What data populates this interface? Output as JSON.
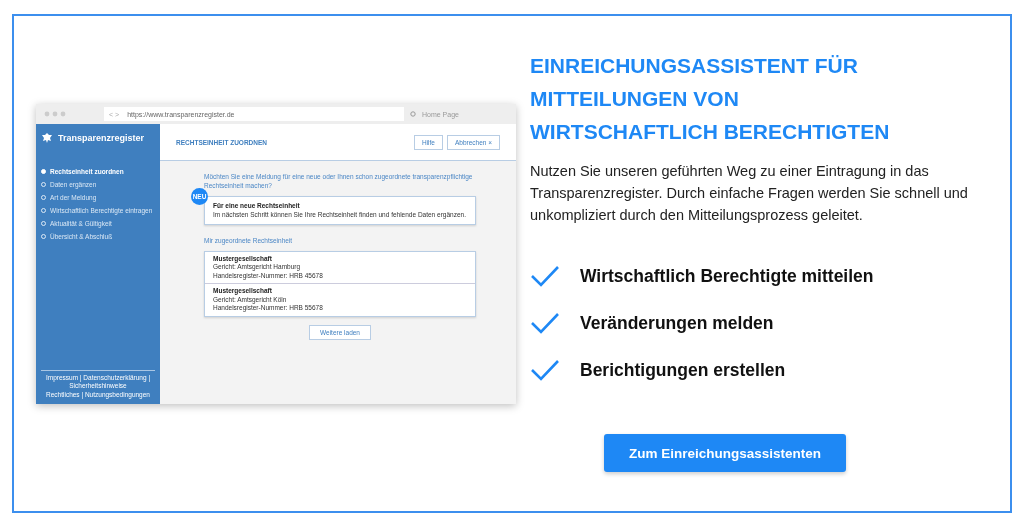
{
  "mockup": {
    "browser": {
      "nav": "< >",
      "url": "https://www.transparenzregister.de",
      "home": "Home Page"
    },
    "sidebar": {
      "brand": "Transparenzregister",
      "steps": [
        {
          "label": "Rechtseinheit zuordnen",
          "selected": true
        },
        {
          "label": "Daten ergänzen",
          "selected": false
        },
        {
          "label": "Art der Meldung",
          "selected": false
        },
        {
          "label": "Wirtschaftlich Berechtigte eintragen",
          "selected": false
        },
        {
          "label": "Aktualität & Gültigkeit",
          "selected": false
        },
        {
          "label": "Übersicht & Abschluß",
          "selected": false
        }
      ],
      "footer": [
        "Impressum | Datenschutzerklärung | Sicherheitshinweise",
        "Rechtliches | Nutzungsbedingungen"
      ]
    },
    "header": {
      "title": "RECHTSEINHEIT ZUORDNEN",
      "buttons": [
        "Hilfe",
        "Abbrechen ×"
      ]
    },
    "question": "Möchten Sie eine Meldung für eine neue oder Ihnen schon zugeordnete transparenzpflichtige Rechtseinheit machen?",
    "new_card": {
      "badge": "NEU",
      "title": "Für eine neue Rechtseinheit",
      "text": "Im nächsten Schritt können Sie Ihre Rechtseinheit finden und fehlende Daten ergänzen."
    },
    "assigned_heading": "Mir zugeordnete Rechtseinheit",
    "entities": [
      {
        "name": "Mustergesellschaft",
        "court": "Gericht: Amtsgericht Hamburg",
        "number": "Handelsregister-Nummer: HRB 45678"
      },
      {
        "name": "Mustergesellschaft",
        "court": "Gericht: Amtsgericht Köln",
        "number": "Handelsregister-Nummer: HRB 55678"
      }
    ],
    "load_more": "Weitere laden"
  },
  "title_lines": [
    "EINREICHUNGSASSISTENT FÜR",
    "MITTEILUNGEN VON",
    "WIRTSCHAFTLICH BERECHTIGTEN"
  ],
  "description": "Nutzen Sie unseren geführten Weg zu einer Eintragung in das Transparenzregister. Durch einfache Fragen werden Sie schnell und unkompliziert durch den Mitteilungsprozess geleitet.",
  "features": [
    "Wirtschaftlich Berechtigte mitteilen",
    "Veränderungen melden",
    "Berichtigungen erstellen"
  ],
  "cta": "Zum Einreichungsassistenten"
}
